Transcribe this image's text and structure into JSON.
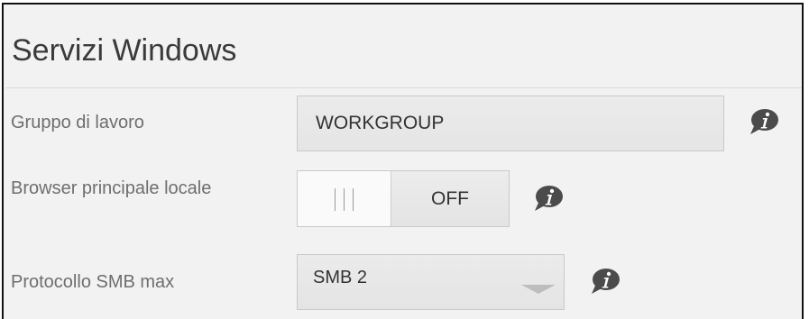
{
  "section": {
    "title": "Servizi Windows"
  },
  "workgroup": {
    "label": "Gruppo di lavoro",
    "value": "WORKGROUP",
    "info_icon": "info-icon"
  },
  "local_master_browser": {
    "label": "Browser principale locale",
    "state": "OFF",
    "enabled": false,
    "info_icon": "info-icon"
  },
  "smb_max_protocol": {
    "label": "Protocollo SMB max",
    "selected": "SMB 2",
    "info_icon": "info-icon"
  },
  "colors": {
    "panel_background": "#f2f2f2",
    "label_text": "#6e6e6e",
    "info_icon": "#4b4b4b"
  }
}
